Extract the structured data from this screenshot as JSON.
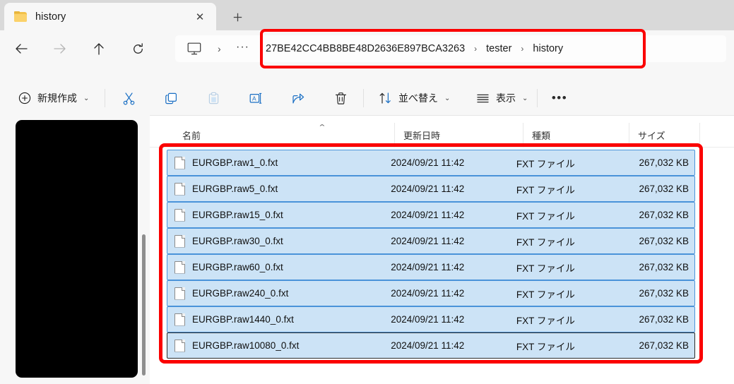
{
  "window": {
    "tab": {
      "title": "history",
      "folder_icon": "folder-icon",
      "close_icon": "✕"
    },
    "new_tab_icon": "＋"
  },
  "nav": {
    "back_icon": "arrow-left-icon",
    "forward_icon": "arrow-right-icon",
    "up_icon": "arrow-up-icon",
    "refresh_icon": "refresh-icon"
  },
  "address": {
    "pc_icon": "monitor-icon",
    "separator": "›",
    "ellipsis": "···",
    "breadcrumbs": [
      "27BE42CC4BB8BE48D2636E897BCA3263",
      "tester",
      "history"
    ],
    "chevron": "›",
    "highlight_color": "#fb0000"
  },
  "toolbar": {
    "new_label": "新規作成",
    "new_chevron": "⌄",
    "cut_icon": "scissors-icon",
    "copy_icon": "copy-icon",
    "paste_icon": "paste-icon",
    "rename_icon": "rename-icon",
    "share_icon": "share-icon",
    "delete_icon": "trash-icon",
    "sort_label": "並べ替え",
    "sort_chevron": "⌄",
    "sort_icon": "sort-arrows-icon",
    "view_label": "表示",
    "view_chevron": "⌄",
    "view_icon": "list-view-icon",
    "more_label": "•••"
  },
  "columns": {
    "name": "名前",
    "date": "更新日時",
    "type": "種類",
    "size": "サイズ",
    "sort_caret": "⌃"
  },
  "files": [
    {
      "name": "EURGBP.raw1_0.fxt",
      "date": "2024/09/21 11:42",
      "type": "FXT ファイル",
      "size": "267,032 KB"
    },
    {
      "name": "EURGBP.raw5_0.fxt",
      "date": "2024/09/21 11:42",
      "type": "FXT ファイル",
      "size": "267,032 KB"
    },
    {
      "name": "EURGBP.raw15_0.fxt",
      "date": "2024/09/21 11:42",
      "type": "FXT ファイル",
      "size": "267,032 KB"
    },
    {
      "name": "EURGBP.raw30_0.fxt",
      "date": "2024/09/21 11:42",
      "type": "FXT ファイル",
      "size": "267,032 KB"
    },
    {
      "name": "EURGBP.raw60_0.fxt",
      "date": "2024/09/21 11:42",
      "type": "FXT ファイル",
      "size": "267,032 KB"
    },
    {
      "name": "EURGBP.raw240_0.fxt",
      "date": "2024/09/21 11:42",
      "type": "FXT ファイル",
      "size": "267,032 KB"
    },
    {
      "name": "EURGBP.raw1440_0.fxt",
      "date": "2024/09/21 11:42",
      "type": "FXT ファイル",
      "size": "267,032 KB"
    },
    {
      "name": "EURGBP.raw10080_0.fxt",
      "date": "2024/09/21 11:42",
      "type": "FXT ファイル",
      "size": "267,032 KB"
    }
  ],
  "colors": {
    "selection_bg": "#cce3f6",
    "selection_border": "#4a93d9",
    "highlight": "#fb0000",
    "redacted": "#000000"
  }
}
